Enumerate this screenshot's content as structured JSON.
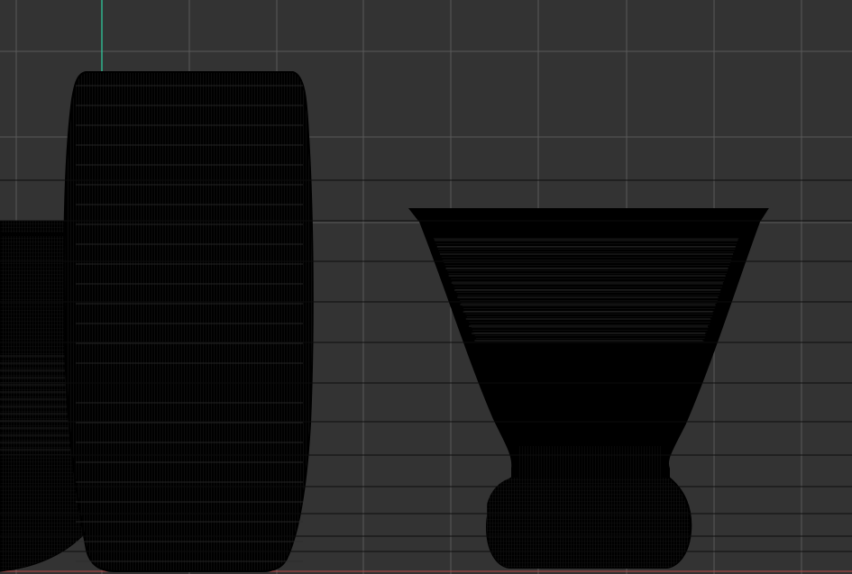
{
  "viewport": {
    "mode": "wireframe",
    "background_color": "#333333",
    "grid_color": "#5a5a5a",
    "y_axis_color": "#2fd1a3",
    "x_axis_color": "#c24a4a",
    "mesh_fill_color": "#000000",
    "mesh_line_color": "#2a2a2a"
  },
  "objects": [
    {
      "name": "bowl-glass",
      "visible": "partial"
    },
    {
      "name": "tall-tumbler-glass",
      "visible": "full"
    },
    {
      "name": "cocktail-glass",
      "visible": "full"
    }
  ]
}
